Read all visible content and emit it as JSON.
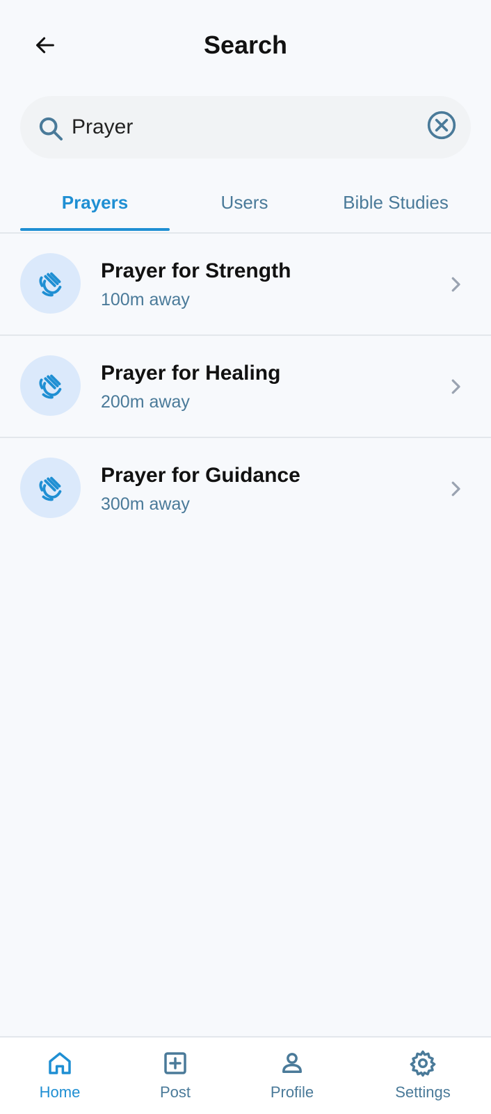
{
  "header": {
    "title": "Search",
    "back_icon": "arrow-left-icon"
  },
  "search": {
    "value": "Prayer",
    "placeholder": "",
    "search_icon": "search-icon",
    "clear_icon": "clear-circle-icon"
  },
  "tabs": [
    {
      "label": "Prayers",
      "active": true
    },
    {
      "label": "Users",
      "active": false
    },
    {
      "label": "Bible Studies",
      "active": false
    }
  ],
  "results": [
    {
      "title": "Prayer for Strength",
      "distance": "100m away",
      "icon": "praying-hands-icon"
    },
    {
      "title": "Prayer for Healing",
      "distance": "200m away",
      "icon": "praying-hands-icon"
    },
    {
      "title": "Prayer for Guidance",
      "distance": "300m away",
      "icon": "praying-hands-icon"
    }
  ],
  "bottom_nav": [
    {
      "label": "Home",
      "icon": "home-icon",
      "active": true
    },
    {
      "label": "Post",
      "icon": "add-square-icon",
      "active": false
    },
    {
      "label": "Profile",
      "icon": "user-icon",
      "active": false
    },
    {
      "label": "Settings",
      "icon": "gear-icon",
      "active": false
    }
  ],
  "colors": {
    "accent": "#1f8fd3",
    "secondary_text": "#4a7a99",
    "background": "#f7f9fc",
    "avatar_bg": "#dbe9fb"
  }
}
